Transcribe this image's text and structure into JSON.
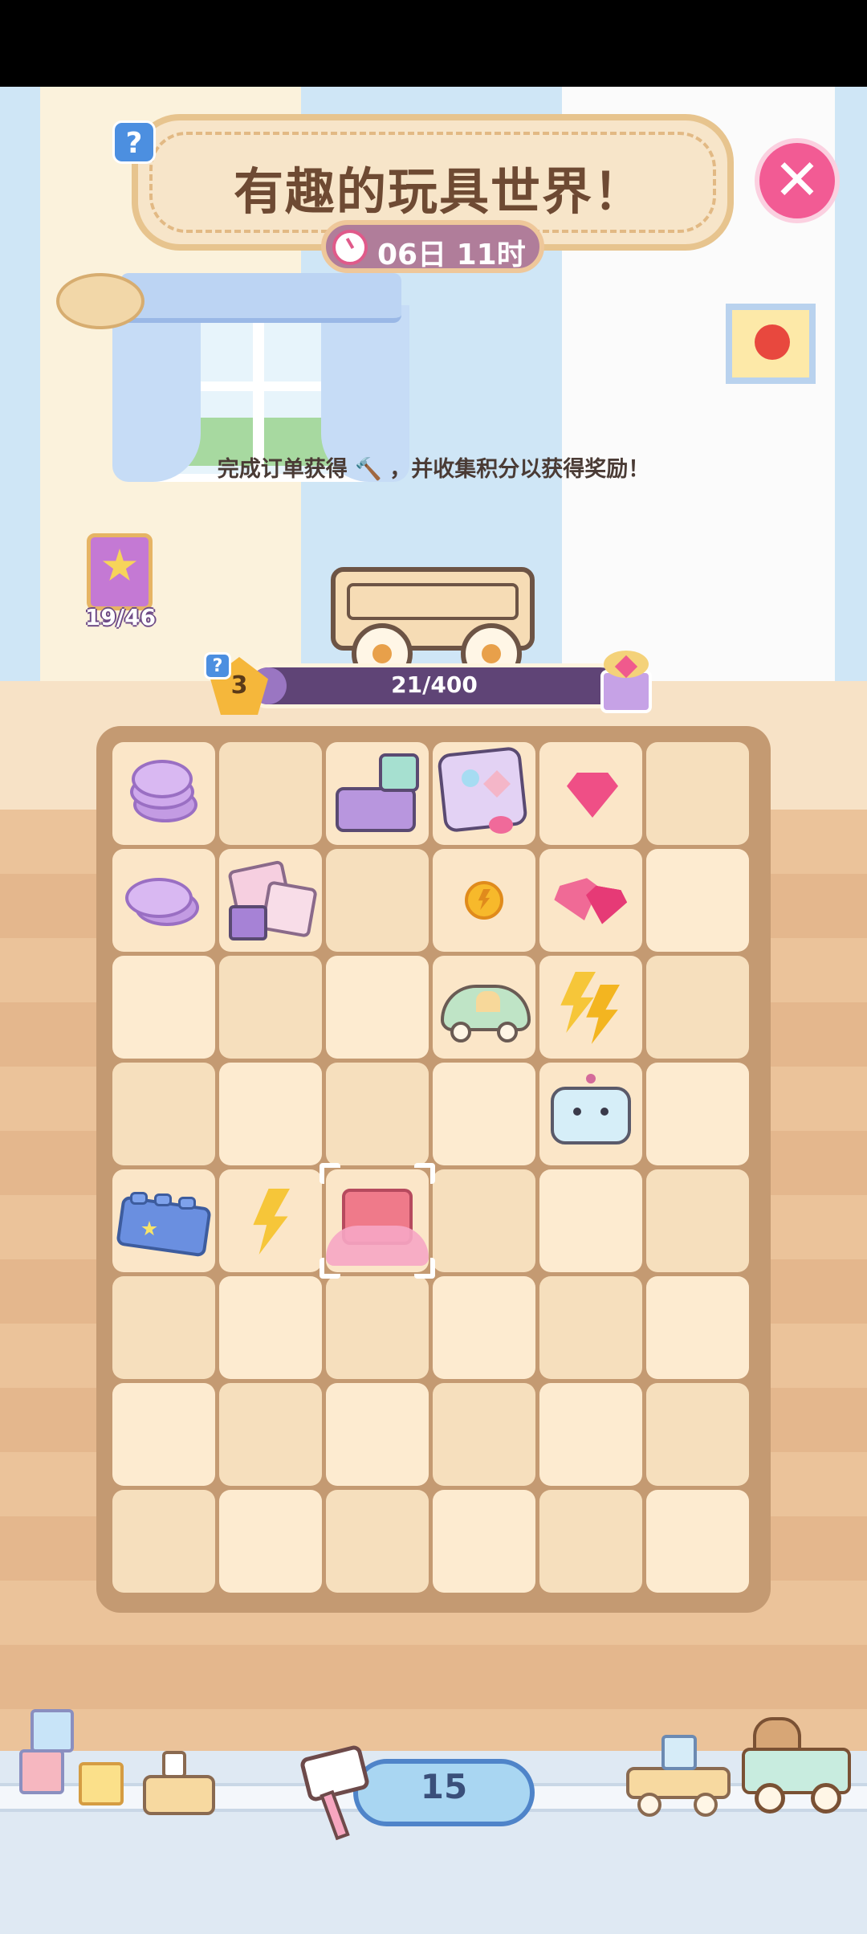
{
  "title": "有趣的玩具世界！",
  "timer": "06日 11时",
  "info_text": "完成订单获得 🔨 ，并收集积分以获得奖励！",
  "album": {
    "count": "19/46"
  },
  "progress": {
    "level": "3",
    "text": "21/400",
    "value": 21,
    "max": 400
  },
  "hammer": {
    "count": "15"
  },
  "help_label": "?",
  "close_label": "✕",
  "colors": {
    "accent": "#f25b94",
    "progress": "#5f4476",
    "board": "#c49a72"
  },
  "board": {
    "rows": 8,
    "cols": 6,
    "items": [
      {
        "row": 0,
        "col": 0,
        "name": "purple-coin-stack-item"
      },
      {
        "row": 0,
        "col": 2,
        "name": "toy-building-blocks-item"
      },
      {
        "row": 0,
        "col": 3,
        "name": "shape-sorter-cube-item"
      },
      {
        "row": 0,
        "col": 4,
        "name": "pink-gem-item"
      },
      {
        "row": 1,
        "col": 0,
        "name": "purple-coins-item"
      },
      {
        "row": 1,
        "col": 1,
        "name": "pink-cubes-item"
      },
      {
        "row": 1,
        "col": 3,
        "name": "gold-coin-item"
      },
      {
        "row": 1,
        "col": 4,
        "name": "pink-gems-item"
      },
      {
        "row": 2,
        "col": 3,
        "name": "toy-car-item"
      },
      {
        "row": 2,
        "col": 4,
        "name": "lightning-bolts-item"
      },
      {
        "row": 3,
        "col": 4,
        "name": "toy-robot-item"
      },
      {
        "row": 4,
        "col": 0,
        "name": "blue-lego-brick-item"
      },
      {
        "row": 4,
        "col": 1,
        "name": "lightning-bolt-item"
      },
      {
        "row": 4,
        "col": 2,
        "name": "pink-brick-selected-item"
      }
    ],
    "selected": {
      "row": 4,
      "col": 2
    }
  }
}
